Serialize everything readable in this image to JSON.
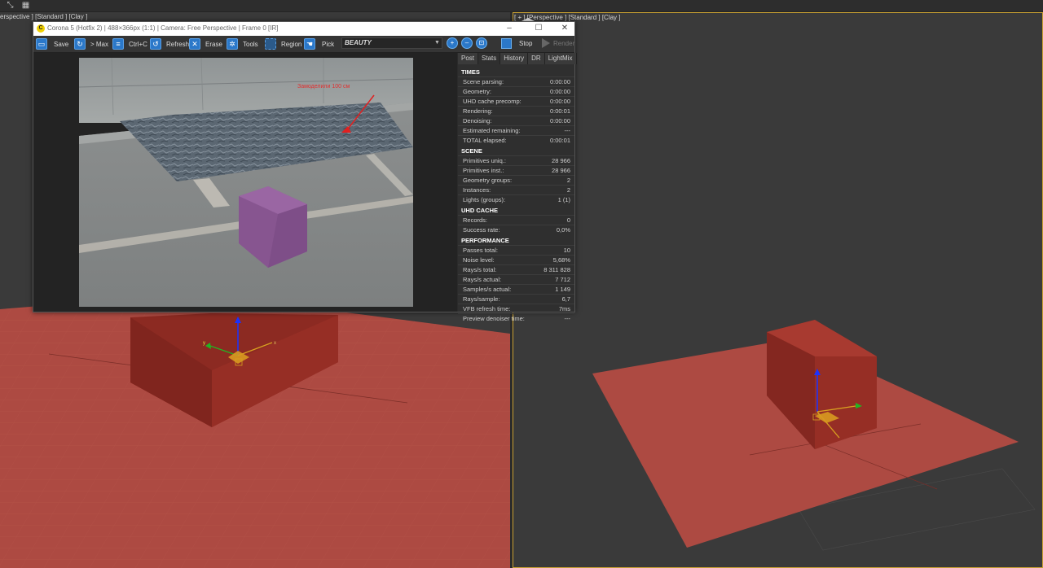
{
  "viewports": {
    "left_label": "erspective ] [Standard ] [Clay ]",
    "right_label": "[ + ] [Perspective ] [Standard ] [Clay ]"
  },
  "gizmo": {
    "x": "x",
    "y": "y"
  },
  "vfb": {
    "title": "Corona 5 (Hotfix 2) | 488×366px (1:1) | Camera: Free Perspective | Frame 0 [IR]",
    "logo": "C",
    "toolbar": {
      "save": "Save",
      "max": "> Max",
      "ctrlc": "Ctrl+C",
      "refresh": "Refresh",
      "erase": "Erase",
      "tools": "Tools",
      "region": "Region",
      "pick": "Pick",
      "channel": "BEAUTY",
      "stop": "Stop",
      "render": "Render"
    },
    "annotation": "Замоделили 100 см",
    "tabs": [
      "Post",
      "Stats",
      "History",
      "DR",
      "LightMix"
    ],
    "sections": [
      {
        "title": "TIMES",
        "rows": [
          {
            "k": "Scene parsing:",
            "v": "0:00:00"
          },
          {
            "k": "Geometry:",
            "v": "0:00:00"
          },
          {
            "k": "UHD cache precomp:",
            "v": "0:00:00"
          },
          {
            "k": "Rendering:",
            "v": "0:00:01"
          },
          {
            "k": "Denoising:",
            "v": "0:00:00"
          },
          {
            "k": "Estimated remaining:",
            "v": "---"
          },
          {
            "k": "TOTAL elapsed:",
            "v": "0:00:01"
          }
        ]
      },
      {
        "title": "SCENE",
        "rows": [
          {
            "k": "Primitives uniq.:",
            "v": "28 966"
          },
          {
            "k": "Primitives inst.:",
            "v": "28 966"
          },
          {
            "k": "Geometry groups:",
            "v": "2"
          },
          {
            "k": "Instances:",
            "v": "2"
          },
          {
            "k": "Lights (groups):",
            "v": "1 (1)"
          }
        ]
      },
      {
        "title": "UHD CACHE",
        "rows": [
          {
            "k": "Records:",
            "v": "0"
          },
          {
            "k": "Success rate:",
            "v": "0,0%"
          }
        ]
      },
      {
        "title": "PERFORMANCE",
        "rows": [
          {
            "k": "Passes total:",
            "v": "10"
          },
          {
            "k": "Noise level:",
            "v": "5,68%"
          },
          {
            "k": "Rays/s total:",
            "v": "8 311 828"
          },
          {
            "k": "Rays/s actual:",
            "v": "7 712"
          },
          {
            "k": "Samples/s actual:",
            "v": "1 149"
          },
          {
            "k": "Rays/sample:",
            "v": "6,7"
          },
          {
            "k": "VFB refresh time:",
            "v": "7ms"
          },
          {
            "k": "Preview denoiser time:",
            "v": "---"
          }
        ]
      }
    ]
  }
}
